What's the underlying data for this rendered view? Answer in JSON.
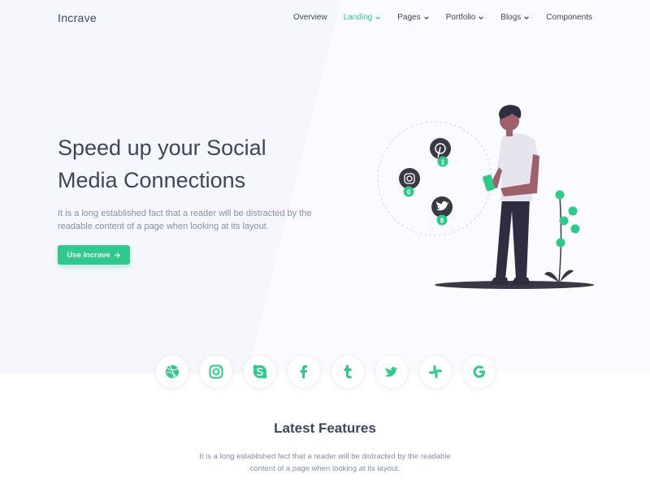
{
  "brand": "Incrave",
  "nav": {
    "items": [
      {
        "label": "Overview",
        "dropdown": false,
        "active": false
      },
      {
        "label": "Landing",
        "dropdown": true,
        "active": true
      },
      {
        "label": "Pages",
        "dropdown": true,
        "active": false
      },
      {
        "label": "Portfolio",
        "dropdown": true,
        "active": false
      },
      {
        "label": "Blogs",
        "dropdown": true,
        "active": false
      },
      {
        "label": "Components",
        "dropdown": false,
        "active": false
      }
    ]
  },
  "hero": {
    "title_line1": "Speed up your Social",
    "title_line2": "Media Connections",
    "text": "It is a long established fact that a reader will be distracted by the readable content of a page when looking at its layout.",
    "cta_label": "Use Incrave",
    "badges": {
      "pinterest": "1",
      "instagram": "6",
      "twitter": "8"
    }
  },
  "social_icons": [
    "dribbble-icon",
    "instagram-icon",
    "skype-icon",
    "facebook-icon",
    "tumblr-icon",
    "twitter-icon",
    "slack-icon",
    "google-icon"
  ],
  "features": {
    "title": "Latest Features",
    "text": "It is a long established fact that a reader will be distracted by the readable content of a page when looking at its layout."
  },
  "colors": {
    "accent": "#2eca8b",
    "heading": "#3c4858",
    "muted": "#8492a6",
    "hero_bg": "#f6f6fd"
  }
}
